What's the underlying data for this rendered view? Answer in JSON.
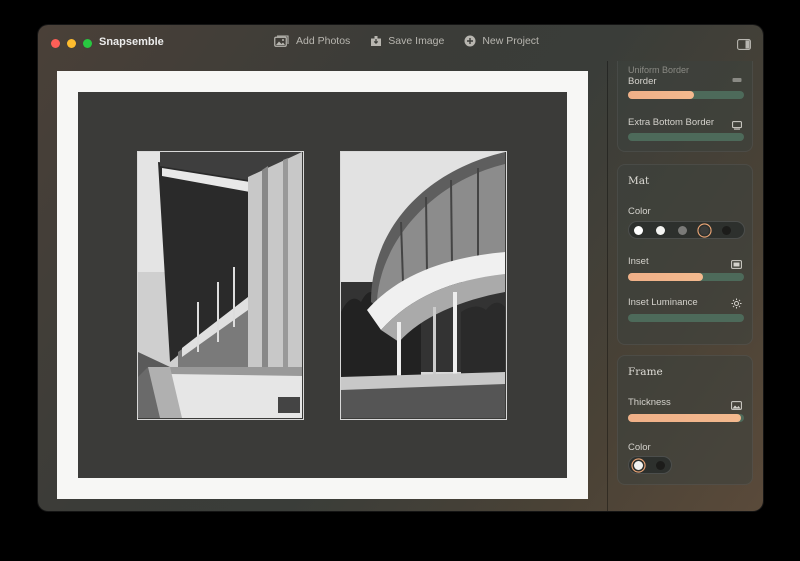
{
  "window": {
    "title": "Snapsemble"
  },
  "toolbar": {
    "add_photos": "Add Photos",
    "save_image": "Save Image",
    "new_project": "New Project"
  },
  "panel": {
    "border_card": {
      "cut_label": "Border",
      "cut_label_top": "Uniform Border",
      "border_value": 0.57,
      "extra_bottom_label": "Extra Bottom Border",
      "extra_bottom_value": 0.0
    },
    "mat_card": {
      "title": "Mat",
      "color_label": "Color",
      "colors": [
        "#ffffff",
        "#f4f4f2",
        "#7a7a78",
        "#3b3b39",
        "#1c1c1a"
      ],
      "selected_color_index": 3,
      "inset_label": "Inset",
      "inset_value": 0.65,
      "inset_luminance_label": "Inset Luminance",
      "inset_luminance_value": 0.0
    },
    "frame_card": {
      "title": "Frame",
      "thickness_label": "Thickness",
      "thickness_value": 0.97,
      "color_label": "Color",
      "colors": [
        "#f2f2f0",
        "#1c1c1a"
      ],
      "selected_color_index": 0
    }
  },
  "icons": {
    "add_photos": "photo-stack-icon",
    "save_image": "save-icon",
    "new_project": "plus-circle-icon",
    "sidebar": "sidebar-icon",
    "extra_bottom": "monitor-icon",
    "inset": "inset-icon",
    "luminance": "sun-icon",
    "thickness": "photo-icon"
  }
}
